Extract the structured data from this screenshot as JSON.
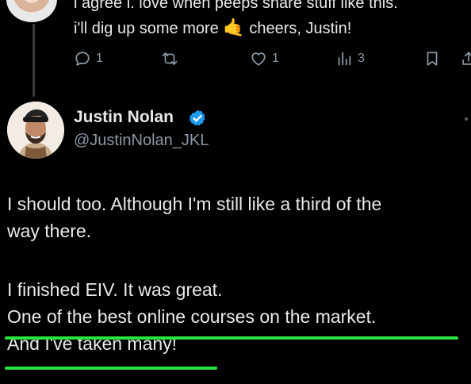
{
  "parent_tweet": {
    "text_line_1": "i agree i. love when peeps share stuff like this.",
    "text_line_2_before": "i'll dig up some more",
    "text_line_2_emoji": "🤙",
    "text_line_2_after": "cheers, Justin!",
    "reply_count": "1",
    "like_count": "1",
    "views_count": "3",
    "icons": [
      "reply-icon",
      "repost-icon",
      "like-icon",
      "views-icon",
      "bookmark-icon",
      "share-icon"
    ]
  },
  "tweet": {
    "display_name": "Justin Nolan",
    "handle": "@JustinNolan_JKL",
    "verified": true,
    "body": {
      "line_1": "I should too. Although I'm still like a third of the",
      "line_2": "way there.",
      "line_3": "I finished EIV. It was great.",
      "line_4": "One of the best online courses on the market.",
      "line_5": "And I've taken many!"
    }
  },
  "colors": {
    "background": "#000000",
    "text": "#e7e9ea",
    "muted": "#8b98a5",
    "verified_blue": "#1d9bf0",
    "highlight_underline": "#29e33f"
  }
}
